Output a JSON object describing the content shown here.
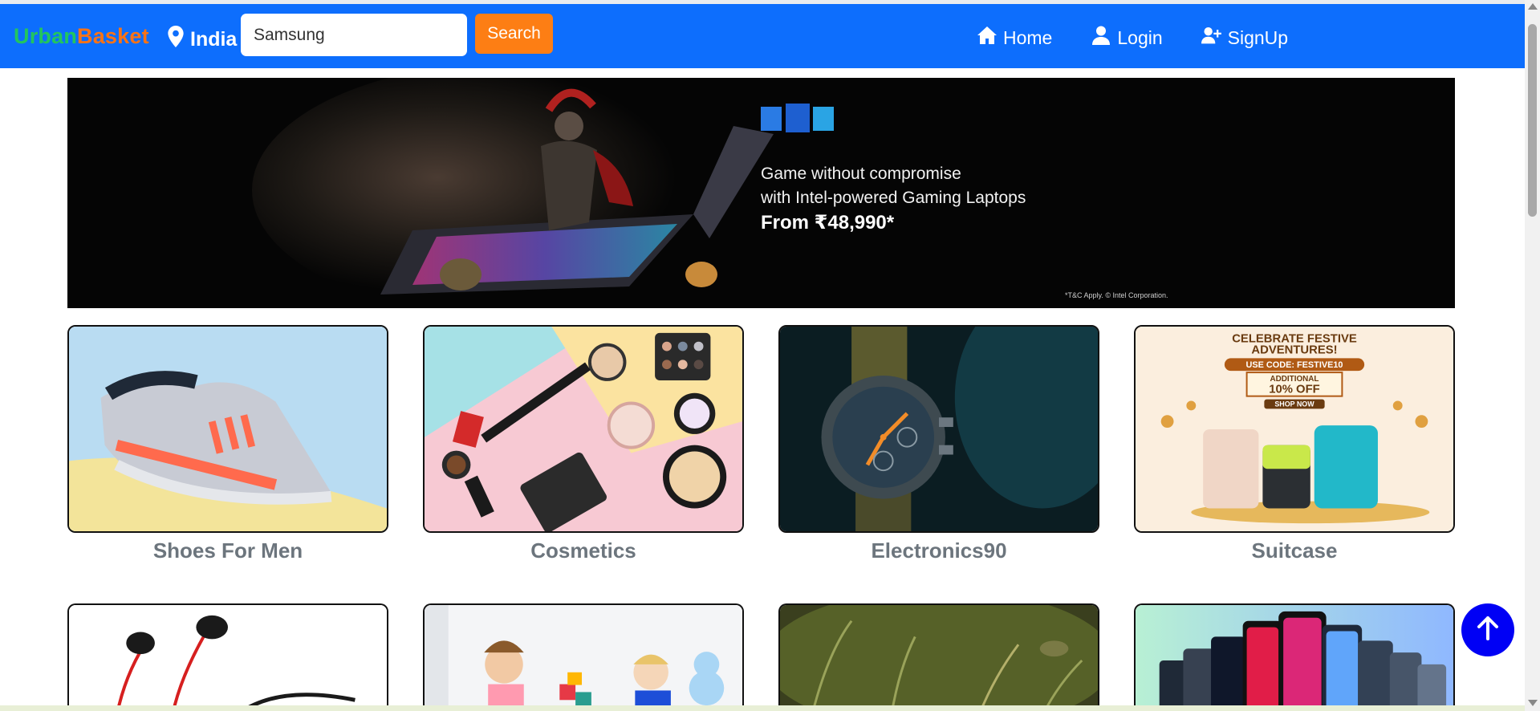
{
  "brand": {
    "part1": "Urban",
    "part2": "Basket"
  },
  "location": {
    "label": "India",
    "icon": "map-pin-icon"
  },
  "search": {
    "value": "Samsung",
    "placeholder": "Search",
    "button_label": "Search"
  },
  "nav": {
    "items": [
      {
        "label": "Home",
        "icon": "home-icon"
      },
      {
        "label": "Login",
        "icon": "user-icon"
      },
      {
        "label": "SignUp",
        "icon": "user-plus-icon"
      }
    ]
  },
  "banner": {
    "line1": "Game without compromise",
    "line2": "with Intel-powered Gaming Laptops",
    "price": "From ₹48,990*",
    "fine_print": "*T&C Apply. © Intel Corporation."
  },
  "categories": [
    {
      "label": "Shoes For Men"
    },
    {
      "label": "Cosmetics"
    },
    {
      "label": "Electronics90"
    },
    {
      "label": "Suitcase"
    }
  ],
  "suitcase_promo": {
    "headline1": "CELEBRATE FESTIVE",
    "headline2": "ADVENTURES!",
    "code": "USE CODE: FESTIVE10",
    "offer1": "ADDITIONAL",
    "offer2": "10% OFF",
    "cta": "SHOP NOW"
  },
  "colors": {
    "navbar": "#0d6efd",
    "brand_green": "#22c55e",
    "brand_orange": "#f97316",
    "search_button": "#fd7e14",
    "back_to_top": "#0000f5"
  },
  "back_to_top": {
    "icon": "arrow-up-icon"
  }
}
